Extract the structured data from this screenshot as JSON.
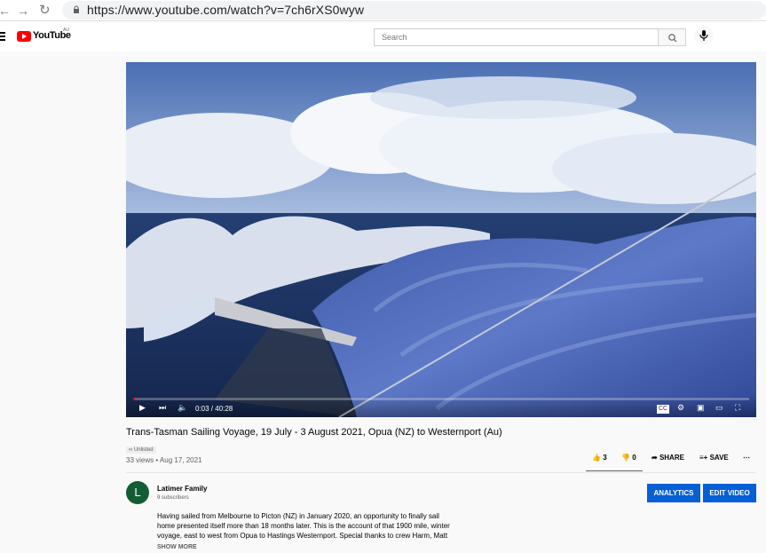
{
  "browser": {
    "url": "https://www.youtube.com/watch?v=7ch6rXS0wyw",
    "back_icon": "back-arrow-icon",
    "forward_icon": "forward-arrow-icon",
    "reload_icon": "reload-icon",
    "lock_icon": "lock-icon"
  },
  "header": {
    "logo_text": "YouTube",
    "country": "AU",
    "search_placeholder": "Search",
    "search_icon": "search-icon",
    "mic_icon": "microphone-icon"
  },
  "player": {
    "time": "0:03 / 40:28",
    "progress": 0.0012,
    "icons": [
      "play-icon",
      "next-icon",
      "volume-icon",
      "captions-icon",
      "settings-icon",
      "miniplayer-icon",
      "theater-icon",
      "fullscreen-icon"
    ]
  },
  "video": {
    "title": "Trans-Tasman Sailing Voyage, 19 July - 3 August 2021, Opua (NZ) to Westernport (Au)",
    "visibility": "Unlisted",
    "views_date": "33 views • Aug 17, 2021",
    "likes": "3",
    "dislikes": "0",
    "share": "SHARE",
    "save": "SAVE",
    "more_icon": "more-icon"
  },
  "channel": {
    "avatar_letter": "L",
    "name": "Latimer Family",
    "subscribers": "9 subscribers",
    "analytics": "ANALYTICS",
    "edit": "EDIT VIDEO"
  },
  "description": {
    "lines": [
      "Having sailed from Melbourne to Picton (NZ) in January 2020, an opportunity to finally sail",
      "home presented itself more than 18 months later.  This is the account of that 1900 mile, winter",
      "voyage, east to west from Opua to Hastings Westernport.  Special thanks to crew Harm, Matt"
    ],
    "show_more": "SHOW MORE"
  },
  "colors": {
    "youtube_red": "#ff0000",
    "button_blue": "#065fd4",
    "avatar_green": "#125d34"
  }
}
